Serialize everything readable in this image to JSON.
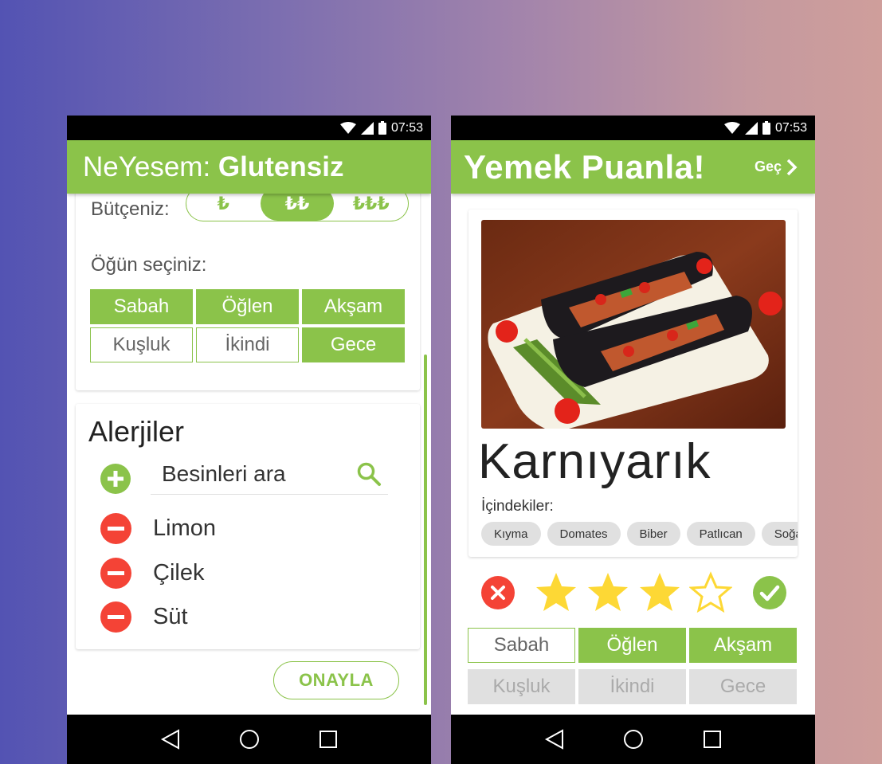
{
  "status": {
    "time": "07:53"
  },
  "left": {
    "app_title_prefix": "NeYesem: ",
    "app_title_bold": "Glutensiz",
    "budget": {
      "label": "Bütçeniz:",
      "options": [
        "₺",
        "₺₺",
        "₺₺₺"
      ],
      "selected": 1
    },
    "meal": {
      "label": "Öğün seçiniz:",
      "options": [
        {
          "label": "Sabah",
          "selected": true
        },
        {
          "label": "Öğlen",
          "selected": true
        },
        {
          "label": "Akşam",
          "selected": true
        },
        {
          "label": "Kuşluk",
          "selected": false
        },
        {
          "label": "İkindi",
          "selected": false
        },
        {
          "label": "Gece",
          "selected": true
        }
      ]
    },
    "allergies": {
      "title": "Alerjiler",
      "search_placeholder": "Besinleri ara",
      "items": [
        "Limon",
        "Çilek",
        "Süt"
      ]
    },
    "confirm_label": "ONAYLA"
  },
  "right": {
    "app_title": "Yemek Puanla!",
    "skip_label": "Geç",
    "food": {
      "name": "Karnıyarık",
      "ingredients_label": "İçindekiler:",
      "ingredients": [
        "Kıyma",
        "Domates",
        "Biber",
        "Patlıcan",
        "Soğan"
      ]
    },
    "rating": {
      "value": 3,
      "max": 4
    },
    "meal": {
      "options": [
        {
          "label": "Sabah",
          "state": "off"
        },
        {
          "label": "Öğlen",
          "state": "on"
        },
        {
          "label": "Akşam",
          "state": "on"
        },
        {
          "label": "Kuşluk",
          "state": "disabled"
        },
        {
          "label": "İkindi",
          "state": "disabled"
        },
        {
          "label": "Gece",
          "state": "disabled"
        }
      ]
    }
  },
  "colors": {
    "accent": "#8bc34a",
    "danger": "#f44336",
    "star": "#fdd835"
  },
  "icons": [
    "wifi-icon",
    "signal-icon",
    "battery-icon",
    "chevron-right-icon",
    "plus-circle-icon",
    "search-icon",
    "minus-circle-icon",
    "close-circle-icon",
    "star-icon",
    "check-circle-icon",
    "back-icon",
    "home-icon",
    "recents-icon"
  ]
}
